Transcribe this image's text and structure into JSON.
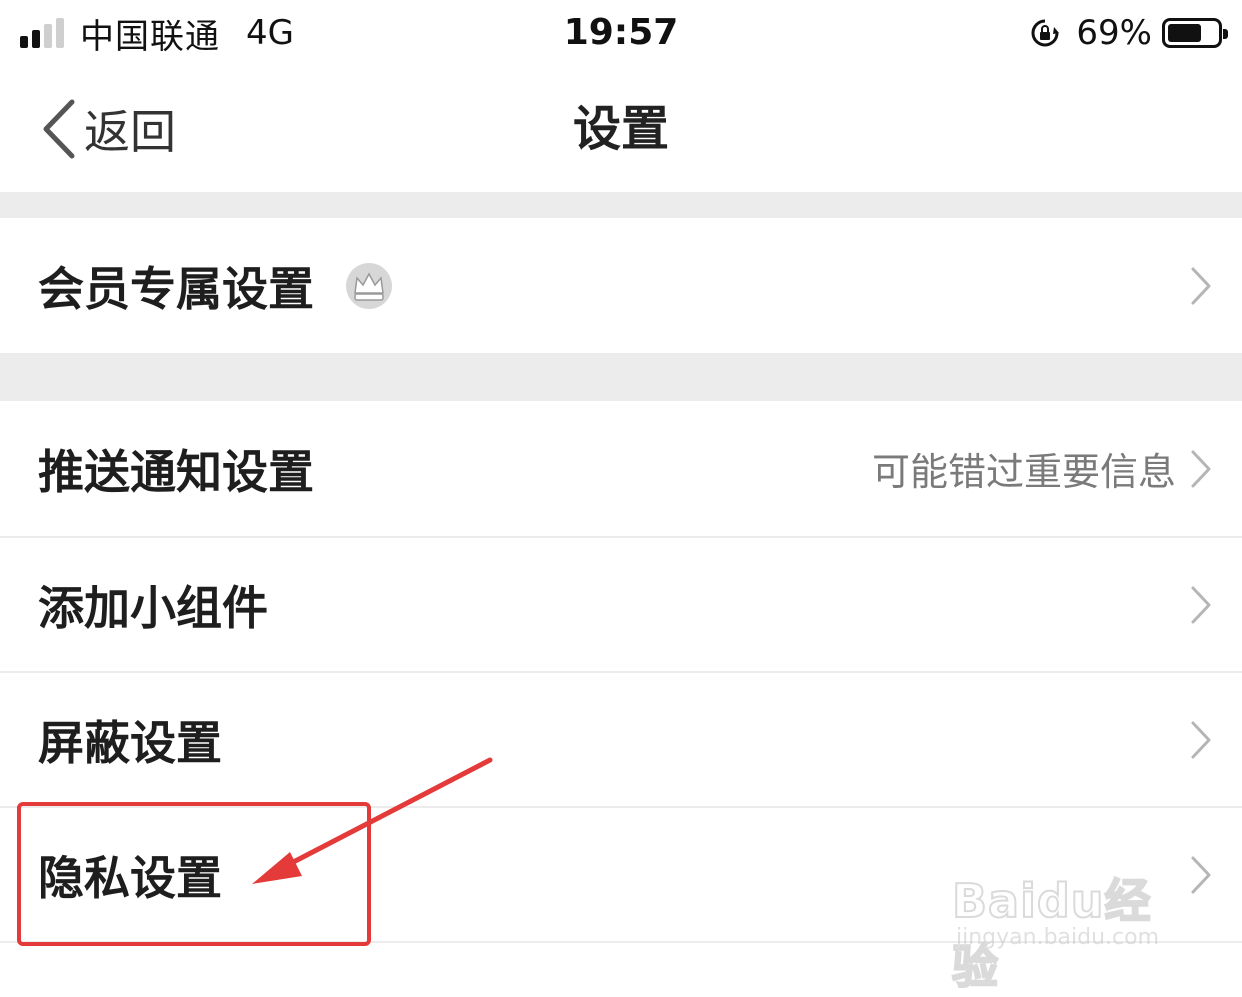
{
  "status_bar": {
    "carrier": "中国联通",
    "network": "4G",
    "time": "19:57",
    "battery_percent": "69%",
    "battery_level": 0.69
  },
  "nav": {
    "back_label": "返回",
    "title": "设置"
  },
  "rows": {
    "vip": {
      "label": "会员专属设置",
      "icon": "crown-icon"
    },
    "push": {
      "label": "推送通知设置",
      "value": "可能错过重要信息"
    },
    "widget": {
      "label": "添加小组件"
    },
    "block": {
      "label": "屏蔽设置"
    },
    "privacy": {
      "label": "隐私设置"
    }
  },
  "annotation": {
    "highlight_color": "#e43a3a"
  },
  "watermark": {
    "brand": "Baidu经验",
    "url": "jingyan.baidu.com"
  }
}
